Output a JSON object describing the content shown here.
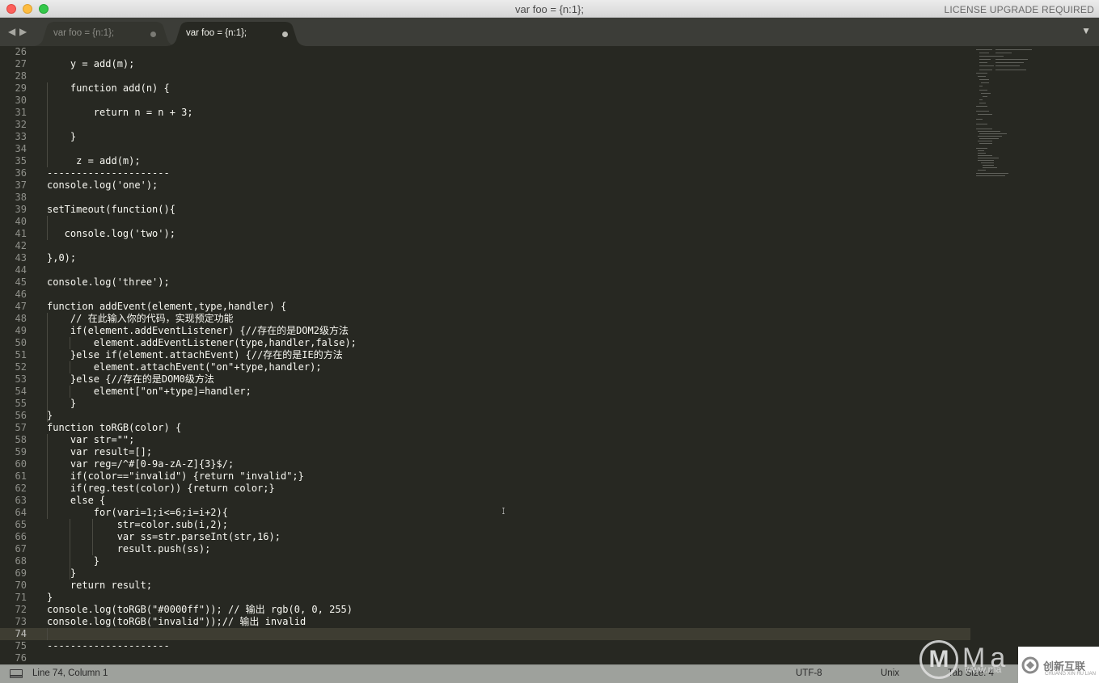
{
  "window": {
    "title": "var foo = {n:1};",
    "license": "LICENSE UPGRADE REQUIRED"
  },
  "tabbar": {
    "nav_back_icon": "triangle-left-icon",
    "nav_forward_icon": "triangle-right-icon",
    "tabs": [
      {
        "label": "var foo = {n:1};",
        "active": false,
        "modified": true
      },
      {
        "label": "var foo = {n:1};",
        "active": true,
        "modified": true
      }
    ],
    "menu_icon": "triangle-down-icon"
  },
  "editor": {
    "colors": {
      "background": "#272822",
      "text": "#f8f8f2",
      "gutter_text": "#8f908a",
      "current_line": "#3e3d32"
    },
    "current_line": 74,
    "lines": [
      {
        "n": "26",
        "text": ""
      },
      {
        "n": "27",
        "text": "    y = add(m);"
      },
      {
        "n": "28",
        "text": ""
      },
      {
        "n": "29",
        "text": "    function add(n) {"
      },
      {
        "n": "30",
        "text": ""
      },
      {
        "n": "31",
        "text": "        return n = n + 3;"
      },
      {
        "n": "32",
        "text": ""
      },
      {
        "n": "33",
        "text": "    }"
      },
      {
        "n": "34",
        "text": ""
      },
      {
        "n": "35",
        "text": "     z = add(m);"
      },
      {
        "n": "36",
        "text": "---------------------"
      },
      {
        "n": "37",
        "text": "console.log('one');"
      },
      {
        "n": "38",
        "text": ""
      },
      {
        "n": "39",
        "text": "setTimeout(function(){"
      },
      {
        "n": "40",
        "text": ""
      },
      {
        "n": "41",
        "text": "   console.log('two');"
      },
      {
        "n": "42",
        "text": ""
      },
      {
        "n": "43",
        "text": "},0);"
      },
      {
        "n": "44",
        "text": ""
      },
      {
        "n": "45",
        "text": "console.log('three');"
      },
      {
        "n": "46",
        "text": ""
      },
      {
        "n": "47",
        "text": "function addEvent(element,type,handler) {"
      },
      {
        "n": "48",
        "text": "    // 在此输入你的代码，实现预定功能"
      },
      {
        "n": "49",
        "text": "    if(element.addEventListener) {//存在的是DOM2级方法"
      },
      {
        "n": "50",
        "text": "        element.addEventListener(type,handler,false);"
      },
      {
        "n": "51",
        "text": "    }else if(element.attachEvent) {//存在的是IE的方法"
      },
      {
        "n": "52",
        "text": "        element.attachEvent(\"on\"+type,handler);"
      },
      {
        "n": "53",
        "text": "    }else {//存在的是DOM0级方法"
      },
      {
        "n": "54",
        "text": "        element[\"on\"+type]=handler;"
      },
      {
        "n": "55",
        "text": "    }"
      },
      {
        "n": "56",
        "text": "}"
      },
      {
        "n": "57",
        "text": "function toRGB(color) {"
      },
      {
        "n": "58",
        "text": "    var str=\"\";"
      },
      {
        "n": "59",
        "text": "    var result=[];"
      },
      {
        "n": "60",
        "text": "    var reg=/^#[0-9a-zA-Z]{3}$/;"
      },
      {
        "n": "61",
        "text": "    if(color==\"invalid\") {return \"invalid\";}"
      },
      {
        "n": "62",
        "text": "    if(reg.test(color)) {return color;}"
      },
      {
        "n": "63",
        "text": "    else {"
      },
      {
        "n": "64",
        "text": "        for(vari=1;i<=6;i=i+2){"
      },
      {
        "n": "65",
        "text": "            str=color.sub(i,2);"
      },
      {
        "n": "66",
        "text": "            var ss=str.parseInt(str,16);"
      },
      {
        "n": "67",
        "text": "            result.push(ss);"
      },
      {
        "n": "68",
        "text": "        }"
      },
      {
        "n": "69",
        "text": "    }"
      },
      {
        "n": "70",
        "text": "    return result;"
      },
      {
        "n": "71",
        "text": "}"
      },
      {
        "n": "72",
        "text": "console.log(toRGB(\"#0000ff\")); // 输出 rgb(0, 0, 255)"
      },
      {
        "n": "73",
        "text": "console.log(toRGB(\"invalid\"));// 输出 invalid"
      },
      {
        "n": "74",
        "text": ""
      },
      {
        "n": "75",
        "text": "---------------------"
      },
      {
        "n": "76",
        "text": ""
      }
    ]
  },
  "statusbar": {
    "panel_icon": "console-panel-icon",
    "position": "Line 74, Column 1",
    "encoding": "UTF-8",
    "line_endings": "Unix",
    "tab_size": "Tab Size: 4"
  },
  "watermark": {
    "letter": "M",
    "text": "Ma",
    "url": "www.ma",
    "brand_name": "创新互联",
    "brand_sub": "CHUANG XIN HU LIAN"
  }
}
